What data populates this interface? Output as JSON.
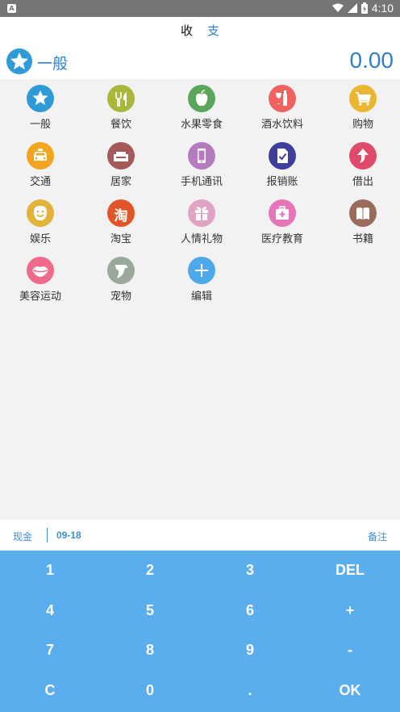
{
  "status": {
    "time": "4:10",
    "notif_glyph": "A"
  },
  "tabs": {
    "income": "收",
    "expense": "支"
  },
  "selected": {
    "label": "一般",
    "amount": "0.00",
    "icon": "star-icon"
  },
  "categories": [
    {
      "label": "一般",
      "icon": "star-icon",
      "color": "#2f9bd6"
    },
    {
      "label": "餐饮",
      "icon": "fork-knife-icon",
      "color": "#a9b83a"
    },
    {
      "label": "水果零食",
      "icon": "apple-icon",
      "color": "#5aa65a"
    },
    {
      "label": "酒水饮料",
      "icon": "wine-bottle-icon",
      "color": "#ef6262"
    },
    {
      "label": "购物",
      "icon": "cart-icon",
      "color": "#e8b630"
    },
    {
      "label": "交通",
      "icon": "taxi-icon",
      "color": "#f2a51e"
    },
    {
      "label": "居家",
      "icon": "sofa-icon",
      "color": "#a55a5a"
    },
    {
      "label": "手机通讯",
      "icon": "phone-icon",
      "color": "#b47cbf"
    },
    {
      "label": "报销账",
      "icon": "checklist-icon",
      "color": "#3e3f9a"
    },
    {
      "label": "借出",
      "icon": "arrow-up-icon",
      "color": "#e04a6a"
    },
    {
      "label": "娱乐",
      "icon": "smiley-icon",
      "color": "#e2b23a"
    },
    {
      "label": "淘宝",
      "icon": "taobao-icon",
      "color": "#e0562a"
    },
    {
      "label": "人情礼物",
      "icon": "gift-icon",
      "color": "#e0a3c3"
    },
    {
      "label": "医疗教育",
      "icon": "medkit-icon",
      "color": "#e675b8"
    },
    {
      "label": "书籍",
      "icon": "book-icon",
      "color": "#9a6b5a"
    },
    {
      "label": "美容运动",
      "icon": "lips-icon",
      "color": "#ef6b8c"
    },
    {
      "label": "宠物",
      "icon": "dog-icon",
      "color": "#9aa99a"
    },
    {
      "label": "编辑",
      "icon": "plus-icon",
      "color": "#4ea8ea"
    }
  ],
  "taobao_glyph": "淘",
  "info": {
    "account": "现金",
    "date": "09-18",
    "note": "备注"
  },
  "keys": [
    "1",
    "2",
    "3",
    "DEL",
    "4",
    "5",
    "6",
    "+",
    "7",
    "8",
    "9",
    "-",
    "C",
    "0",
    ".",
    "OK"
  ]
}
